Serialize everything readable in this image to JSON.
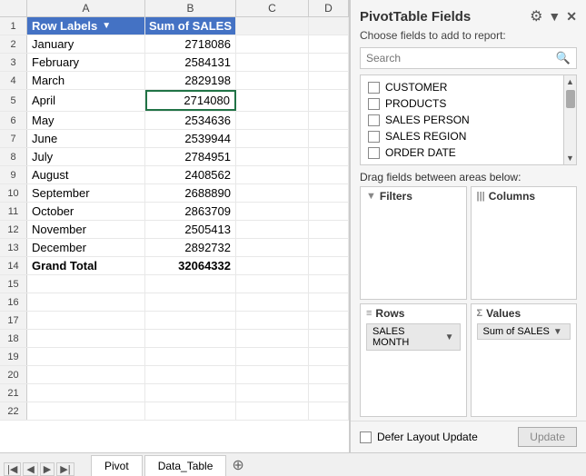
{
  "pivot_panel": {
    "title": "PivotTable Fields",
    "subtitle": "Choose fields to add to report:",
    "search_placeholder": "Search",
    "close_label": "✕",
    "settings_label": "⚙",
    "chevron_label": "▼",
    "fields": [
      {
        "label": "CUSTOMER",
        "checked": false
      },
      {
        "label": "PRODUCTS",
        "checked": false
      },
      {
        "label": "SALES PERSON",
        "checked": false
      },
      {
        "label": "SALES REGION",
        "checked": false
      },
      {
        "label": "ORDER DATE",
        "checked": false
      }
    ],
    "drag_label": "Drag fields between areas below:",
    "areas": {
      "filters": {
        "label": "Filters",
        "icon": "▼",
        "chip": null
      },
      "columns": {
        "label": "Columns",
        "icon": "|||",
        "chip": null
      },
      "rows": {
        "label": "Rows",
        "icon": "≡",
        "chip": "SALES MONTH"
      },
      "values": {
        "label": "Values",
        "icon": "Σ",
        "chip": "Sum of SALES"
      }
    },
    "defer_label": "Defer Layout Update",
    "update_label": "Update"
  },
  "spreadsheet": {
    "col_headers": [
      "A",
      "B",
      "C",
      "D"
    ],
    "row_header_a": "Row Labels",
    "row_header_b": "Sum of SALES",
    "rows": [
      {
        "num": 2,
        "label": "January",
        "value": "2718086"
      },
      {
        "num": 3,
        "label": "February",
        "value": "2584131"
      },
      {
        "num": 4,
        "label": "March",
        "value": "2829198"
      },
      {
        "num": 5,
        "label": "April",
        "value": "2714080",
        "selected": true
      },
      {
        "num": 6,
        "label": "May",
        "value": "2534636"
      },
      {
        "num": 7,
        "label": "June",
        "value": "2539944"
      },
      {
        "num": 8,
        "label": "July",
        "value": "2784951"
      },
      {
        "num": 9,
        "label": "August",
        "value": "2408562"
      },
      {
        "num": 10,
        "label": "September",
        "value": "2688890"
      },
      {
        "num": 11,
        "label": "October",
        "value": "2863709"
      },
      {
        "num": 12,
        "label": "November",
        "value": "2505413"
      },
      {
        "num": 13,
        "label": "December",
        "value": "2892732"
      },
      {
        "num": 14,
        "label": "Grand Total",
        "value": "32064332",
        "grand_total": true
      }
    ],
    "empty_rows": [
      15,
      16,
      17,
      18,
      19,
      20,
      21,
      22
    ]
  },
  "tabs": [
    {
      "label": "Pivot",
      "active": true
    },
    {
      "label": "Data_Table",
      "active": false
    }
  ]
}
